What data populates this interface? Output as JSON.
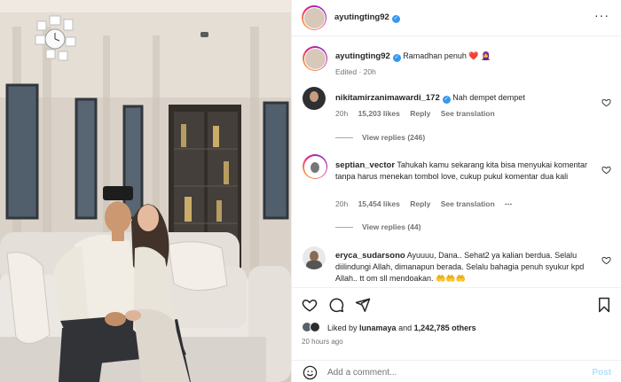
{
  "post": {
    "author": "ayutingting92",
    "menu_icon": "more-horizontal-icon"
  },
  "caption": {
    "username": "ayutingting92",
    "text": "Ramadhan penuh",
    "emoji": "❤️ 🧕",
    "edited": "Edited · 20h"
  },
  "comments": [
    {
      "username": "nikitamirzanimawardi_172",
      "verified": true,
      "text": "Nah dempet dempet",
      "time": "20h",
      "likes": "15,203 likes",
      "reply": "Reply",
      "translation": "See translation",
      "view_replies": "View replies (246)"
    },
    {
      "username": "septian_vector",
      "verified": false,
      "text": "Tahukah kamu sekarang kita bisa menyukai komentar tanpa harus menekan tombol love, cukup pukul komentar dua kali",
      "time": "20h",
      "likes": "15,454 likes",
      "reply": "Reply",
      "translation": "See translation",
      "more": "···",
      "view_replies": "View replies (44)"
    },
    {
      "username": "eryca_sudarsono",
      "verified": false,
      "text": "Ayuuuu, Dana.. Sehat2 ya kalian berdua. Selalu diilindungi Allah, dimanapun berada. Selalu bahagia penuh syukur kpd Allah.. tt om sll mendoakan. 🤲🤲🤲"
    }
  ],
  "footer": {
    "liked_by_prefix": "Liked by",
    "liked_by_user": "lunamaya",
    "liked_by_and": "and",
    "liked_by_others": "1,242,785 others",
    "time_ago": "20 hours ago",
    "add_comment_placeholder": "Add a comment...",
    "post_label": "Post"
  },
  "colors": {
    "verified": "#3897f0",
    "heart": "#ed4956",
    "post_button": "#b2dffc"
  }
}
